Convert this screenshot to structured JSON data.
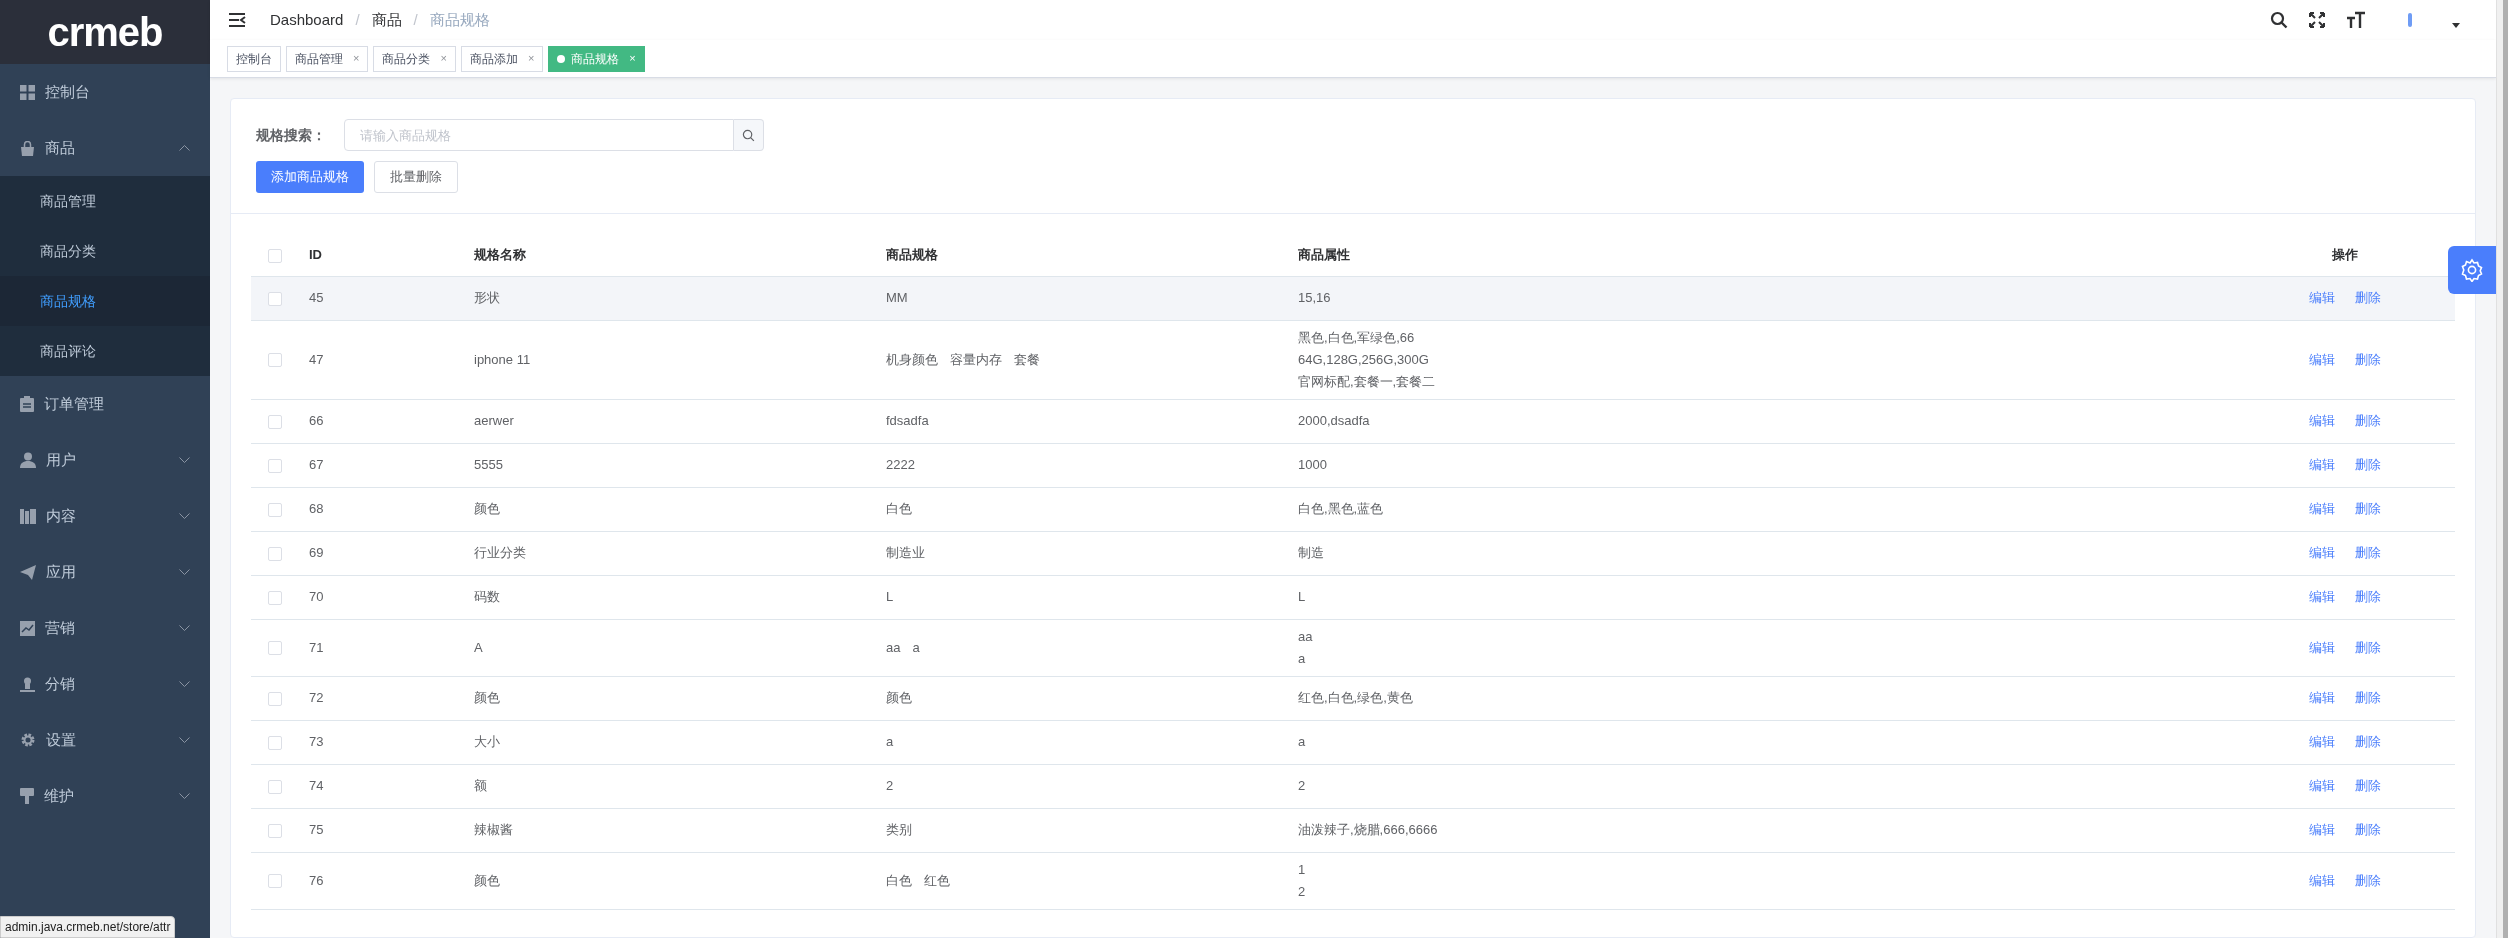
{
  "sidebar": {
    "logo": "crmeb",
    "items": [
      {
        "label": "控制台"
      },
      {
        "label": "商品",
        "expanded": true,
        "children": [
          {
            "label": "商品管理",
            "selected": false
          },
          {
            "label": "商品分类",
            "selected": false
          },
          {
            "label": "商品规格",
            "selected": true
          },
          {
            "label": "商品评论",
            "selected": false
          }
        ]
      },
      {
        "label": "订单管理"
      },
      {
        "label": "用户",
        "expanded": false
      },
      {
        "label": "内容",
        "expanded": false
      },
      {
        "label": "应用",
        "expanded": false
      },
      {
        "label": "营销",
        "expanded": false
      },
      {
        "label": "分销",
        "expanded": false
      },
      {
        "label": "设置",
        "expanded": false
      },
      {
        "label": "维护",
        "expanded": false
      }
    ]
  },
  "breadcrumb": [
    {
      "label": "Dashboard"
    },
    {
      "separator": "/",
      "label": "商品"
    },
    {
      "separator": "/",
      "label": "商品规格"
    }
  ],
  "tabs": [
    {
      "label": "控制台",
      "selected": false
    },
    {
      "label": "商品管理",
      "close": "×",
      "selected": false
    },
    {
      "label": "商品分类",
      "close": "×",
      "selected": false
    },
    {
      "label": "商品添加",
      "close": "×",
      "selected": false
    },
    {
      "label": "商品规格",
      "close": "×",
      "selected": true
    }
  ],
  "search": {
    "label": "规格搜索：",
    "placeholder": "请输入商品规格"
  },
  "buttons": [
    {
      "label": "添加商品规格",
      "kind": "primary"
    },
    {
      "label": "批量删除",
      "kind": "default"
    }
  ],
  "table": {
    "columns": [
      "ID",
      "规格名称",
      "商品规格",
      "商品属性",
      "操作"
    ],
    "header_checked": false,
    "rows": [
      {
        "id": "45",
        "name": "形状",
        "specs": [
          "MM"
        ],
        "attrs": [
          "15,16"
        ],
        "hovered": true,
        "checked": false,
        "actions": [
          "编辑",
          "删除"
        ]
      },
      {
        "id": "47",
        "name": "iphone 11",
        "specs": [
          "机身颜色",
          "容量内存",
          "套餐"
        ],
        "attrs": [
          "黑色,白色,军绿色,66",
          "64G,128G,256G,300G",
          "官网标配,套餐一,套餐二"
        ],
        "hovered": false,
        "checked": false,
        "actions": [
          "编辑",
          "删除"
        ]
      },
      {
        "id": "66",
        "name": "aerwer",
        "specs": [
          "fdsadfa"
        ],
        "attrs": [
          "2000,dsadfa"
        ],
        "hovered": false,
        "checked": false,
        "actions": [
          "编辑",
          "删除"
        ]
      },
      {
        "id": "67",
        "name": "5555",
        "specs": [
          "2222"
        ],
        "attrs": [
          "1000"
        ],
        "hovered": false,
        "checked": false,
        "actions": [
          "编辑",
          "删除"
        ]
      },
      {
        "id": "68",
        "name": "颜色",
        "specs": [
          "白色"
        ],
        "attrs": [
          "白色,黑色,蓝色"
        ],
        "hovered": false,
        "checked": false,
        "actions": [
          "编辑",
          "删除"
        ]
      },
      {
        "id": "69",
        "name": "行业分类",
        "specs": [
          "制造业"
        ],
        "attrs": [
          "制造"
        ],
        "hovered": false,
        "checked": false,
        "actions": [
          "编辑",
          "删除"
        ]
      },
      {
        "id": "70",
        "name": "码数",
        "specs": [
          "L"
        ],
        "attrs": [
          "L"
        ],
        "hovered": false,
        "checked": false,
        "actions": [
          "编辑",
          "删除"
        ]
      },
      {
        "id": "71",
        "name": "A",
        "specs": [
          "aa",
          "a"
        ],
        "attrs": [
          "aa",
          "a"
        ],
        "hovered": false,
        "checked": false,
        "actions": [
          "编辑",
          "删除"
        ]
      },
      {
        "id": "72",
        "name": "颜色",
        "specs": [
          "颜色"
        ],
        "attrs": [
          "红色,白色,绿色,黄色"
        ],
        "hovered": false,
        "checked": false,
        "actions": [
          "编辑",
          "删除"
        ]
      },
      {
        "id": "73",
        "name": "大小",
        "specs": [
          "a"
        ],
        "attrs": [
          "a"
        ],
        "hovered": false,
        "checked": false,
        "actions": [
          "编辑",
          "删除"
        ]
      },
      {
        "id": "74",
        "name": "额",
        "specs": [
          "2"
        ],
        "attrs": [
          "2"
        ],
        "hovered": false,
        "checked": false,
        "actions": [
          "编辑",
          "删除"
        ]
      },
      {
        "id": "75",
        "name": "辣椒酱",
        "specs": [
          "类别"
        ],
        "attrs": [
          "油泼辣子,烧腊,666,6666"
        ],
        "hovered": false,
        "checked": false,
        "actions": [
          "编辑",
          "删除"
        ]
      },
      {
        "id": "76",
        "name": "颜色",
        "specs": [
          "白色",
          "红色"
        ],
        "attrs": [
          "1",
          "2"
        ],
        "hovered": false,
        "checked": false,
        "actions": [
          "编辑",
          "删除"
        ]
      }
    ]
  },
  "status_url": "admin.java.crmeb.net/store/attr"
}
